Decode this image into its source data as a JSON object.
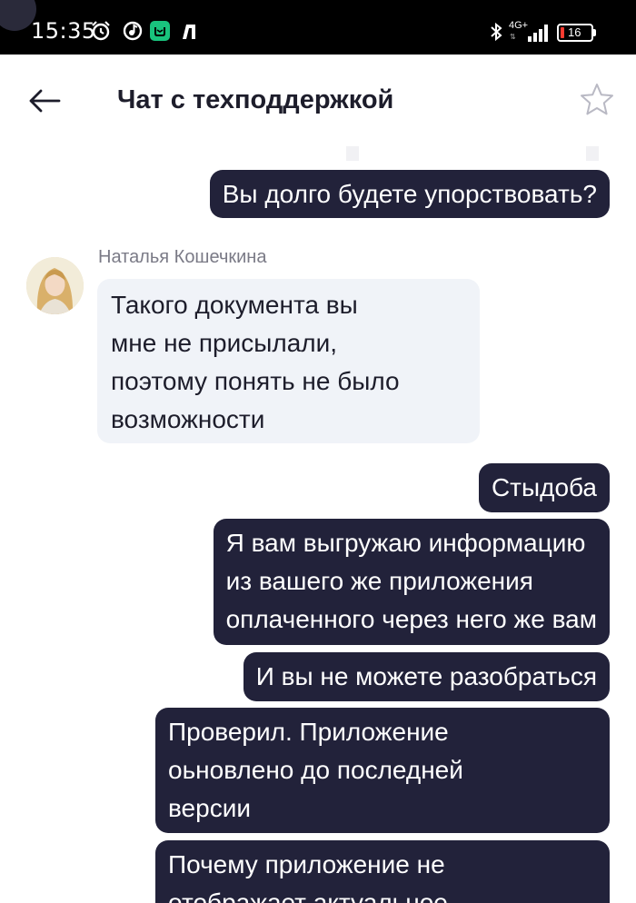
{
  "status_bar": {
    "time": "15:35",
    "network": "4G+",
    "battery": "16",
    "battery_color": "#ff3b30"
  },
  "header": {
    "title": "Чат с техподдержкой",
    "back_icon": "arrow-left-icon",
    "favorite_icon": "star-outline-icon"
  },
  "colors": {
    "outgoing_bubble": "#22223a",
    "incoming_bubble": "#f0f3f8",
    "sender_name": "#7a7a86"
  },
  "messages": [
    {
      "direction": "out",
      "lines": [
        "Вы долго будете упорствовать?"
      ]
    },
    {
      "direction": "in",
      "sender": "Наталья Кошечкина",
      "lines": [
        "Такого документа вы",
        "мне не присылали,",
        "поэтому понять не было",
        "возможности"
      ]
    },
    {
      "direction": "out",
      "lines": [
        "Стыдоба"
      ]
    },
    {
      "direction": "out",
      "lines": [
        "Я вам выгружаю информацию",
        "из вашего же приложения",
        "оплаченного через него же вам"
      ]
    },
    {
      "direction": "out",
      "lines": [
        "И вы не можете разобраться"
      ]
    },
    {
      "direction": "out",
      "lines": [
        "Проверил. Приложение",
        "оьновлено до последней",
        "версии"
      ]
    },
    {
      "direction": "out",
      "lines": [
        "Почему приложение не",
        "отображает актуальное"
      ]
    }
  ]
}
